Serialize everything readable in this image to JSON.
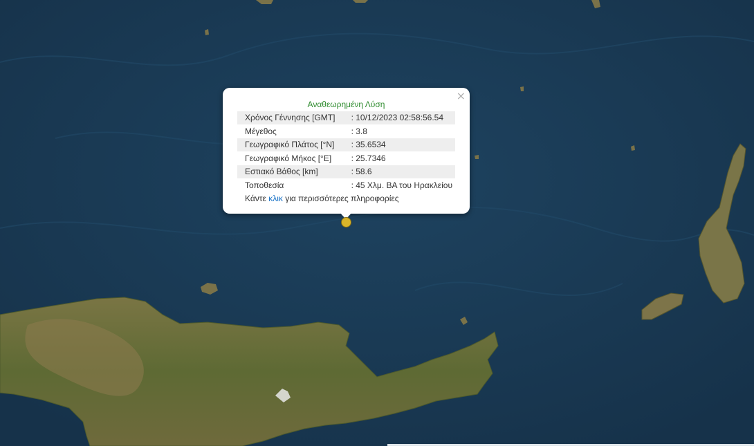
{
  "popup": {
    "title": "Αναθεωρημένη Λύση",
    "close_symbol": "×",
    "rows": [
      {
        "label": "Χρόνος Γέννησης [GMT]",
        "value": ": 10/12/2023 02:58:56.54"
      },
      {
        "label": "Μέγεθος",
        "value": ": 3.8"
      },
      {
        "label": "Γεωγραφικό Πλάτος [°N]",
        "value": ": 35.6534"
      },
      {
        "label": "Γεωγραφικό Μήκος [°E]",
        "value": ": 25.7346"
      },
      {
        "label": "Εστιακό Βάθος [km]",
        "value": ": 58.6"
      },
      {
        "label": "Τοποθεσία",
        "value": ": 45 Χλμ. ΒΑ του Ηρακλείου"
      }
    ],
    "more_prefix": "Κάντε ",
    "more_link": "κλικ",
    "more_suffix": " για περισσότερες πληροφορίες"
  },
  "colors": {
    "sea": "#1a3a52",
    "land": "#6a6a3a",
    "marker": "#d9b52a",
    "title": "#2e8b2e",
    "link": "#1a73c7"
  },
  "map": {
    "marker_icon": "earthquake-marker-icon"
  }
}
